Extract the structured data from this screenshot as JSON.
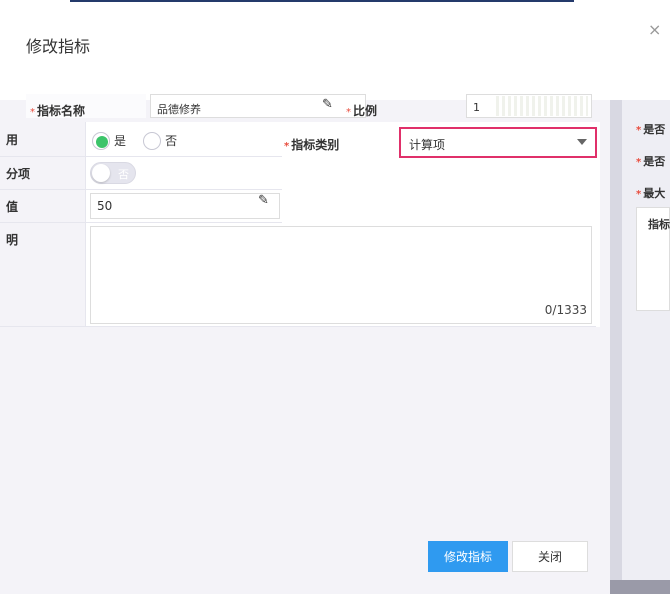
{
  "dialog": {
    "title": "修改指标",
    "close_icon": "×"
  },
  "top_row": {
    "name_label": "指标名称",
    "name_value": "品德修养",
    "ratio_label": "比例",
    "ratio_value": "1"
  },
  "form": {
    "enabled_label": "用",
    "enabled_options": [
      "是",
      "否"
    ],
    "enabled_selected": "是",
    "bonus_label": "分项",
    "bonus_toggle_text": "否",
    "value_label": "值",
    "value_input": "50",
    "desc_label": "明",
    "desc_counter": "0/1333",
    "type_label": "指标类别",
    "type_value": "计算项"
  },
  "right_panel": {
    "items": [
      "是否",
      "是否",
      "最大",
      "指标"
    ]
  },
  "footer": {
    "submit_label": "修改指标",
    "close_label": "关闭"
  },
  "colors": {
    "primary": "#2f9af0",
    "highlight": "#e0306a",
    "radio_on": "#3cc46a"
  }
}
